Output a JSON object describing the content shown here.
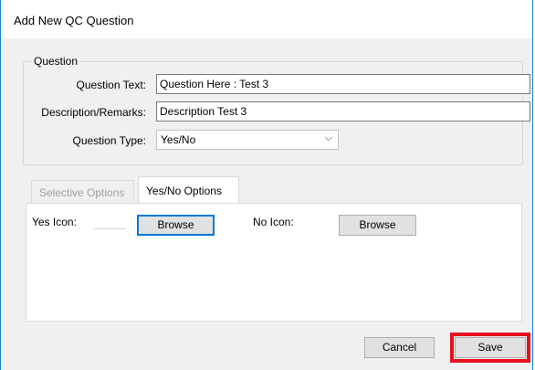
{
  "window": {
    "title": "Add New QC Question"
  },
  "question_group": {
    "legend": "Question",
    "question_text_label": "Question Text:",
    "question_text_value": "Question Here : Test 3",
    "description_label": "Description/Remarks:",
    "description_value": "Description Test 3",
    "question_type_label": "Question Type:",
    "question_type_value": "Yes/No"
  },
  "tabs": {
    "selective_label": "Selective Options",
    "yesno_label": "Yes/No Options"
  },
  "yesno_panel": {
    "yes_icon_label": "Yes Icon:",
    "yes_browse_label": "Browse",
    "no_icon_label": "No Icon:",
    "no_browse_label": "Browse"
  },
  "footer": {
    "cancel_label": "Cancel",
    "save_label": "Save"
  },
  "colors": {
    "window_border": "#1883d7",
    "focus_border": "#0078d7",
    "highlight": "#e8101e"
  }
}
